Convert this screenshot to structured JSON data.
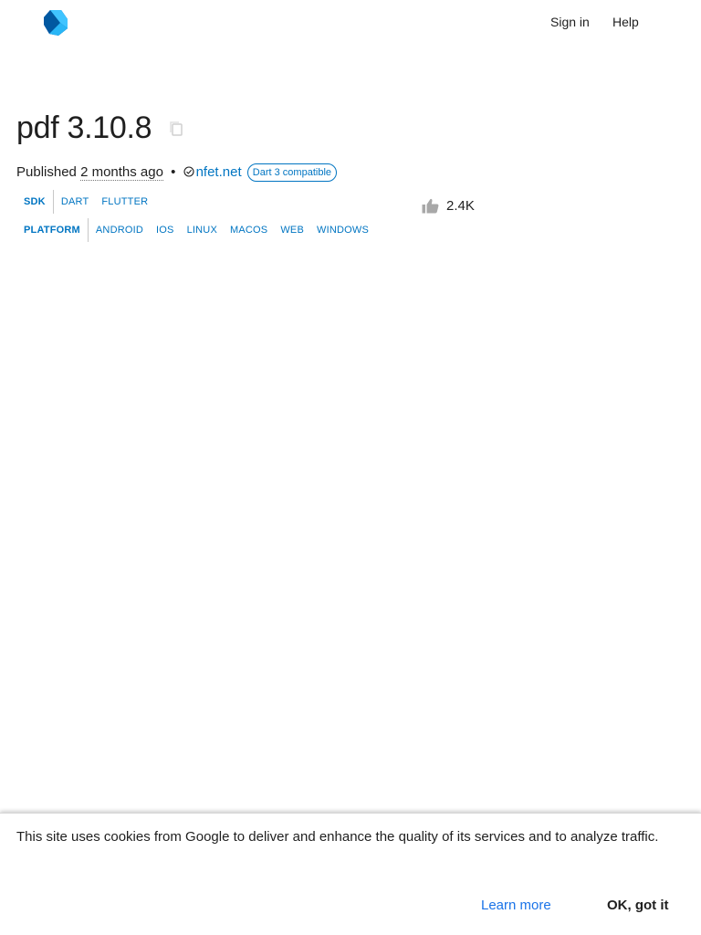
{
  "header": {
    "logo_icon": "dart-logo-icon",
    "signin_label": "Sign in",
    "help_label": "Help"
  },
  "package": {
    "title": "pdf 3.10.8",
    "copy_icon": "copy-icon",
    "published_prefix": "Published",
    "published_when": "2 months ago",
    "bullet": "•",
    "verified_icon": "verified-publisher-icon",
    "publisher": "nfet.net",
    "badge": "Dart 3 compatible"
  },
  "tags": {
    "sdk": {
      "label": "SDK",
      "items": [
        "DART",
        "FLUTTER"
      ]
    },
    "platform": {
      "label": "PLATFORM",
      "items": [
        "ANDROID",
        "IOS",
        "LINUX",
        "MACOS",
        "WEB",
        "WINDOWS"
      ]
    }
  },
  "likes": {
    "icon": "thumb-up-icon",
    "count": "2.4K"
  },
  "cookie_banner": {
    "text": "This site uses cookies from Google to deliver and enhance the quality of its services and to analyze traffic.",
    "learn_more_label": "Learn more",
    "ok_label": "OK, got it"
  },
  "colors": {
    "accent": "#0175c2",
    "link_blue": "#1a73e8",
    "text": "#1f1f1f"
  }
}
